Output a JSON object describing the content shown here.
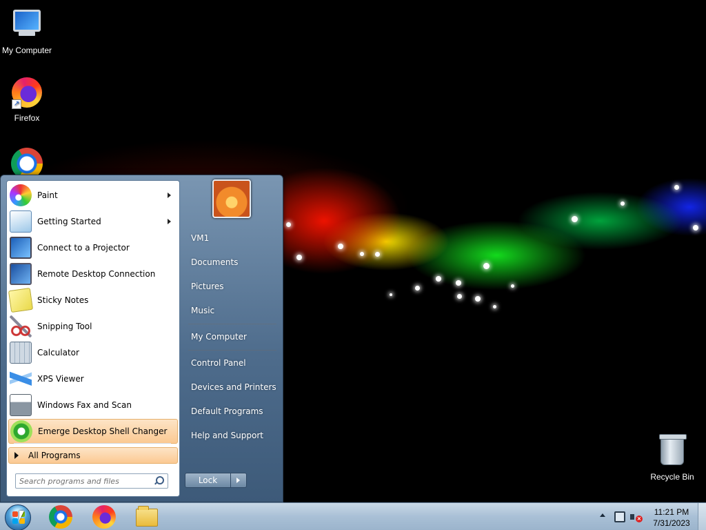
{
  "desktop": {
    "icons": [
      {
        "label": "My Computer",
        "icon": "computer-icon"
      },
      {
        "label": "Firefox",
        "icon": "firefox-icon"
      },
      {
        "label": "",
        "icon": "chrome-icon"
      },
      {
        "label": "Recycle Bin",
        "icon": "recycle-bin-icon"
      }
    ]
  },
  "start_menu": {
    "programs": [
      {
        "label": "Paint",
        "icon": "paint-icon",
        "has_submenu": true
      },
      {
        "label": "Getting Started",
        "icon": "getting-started-icon",
        "has_submenu": true
      },
      {
        "label": "Connect to a Projector",
        "icon": "projector-icon",
        "has_submenu": false
      },
      {
        "label": "Remote Desktop Connection",
        "icon": "remote-desktop-icon",
        "has_submenu": false
      },
      {
        "label": "Sticky Notes",
        "icon": "sticky-notes-icon",
        "has_submenu": false
      },
      {
        "label": "Snipping Tool",
        "icon": "scissors-icon",
        "has_submenu": false
      },
      {
        "label": "Calculator",
        "icon": "calculator-icon",
        "has_submenu": false
      },
      {
        "label": "XPS Viewer",
        "icon": "xps-viewer-icon",
        "has_submenu": false
      },
      {
        "label": "Windows Fax and Scan",
        "icon": "fax-icon",
        "has_submenu": false
      },
      {
        "label": "Emerge Desktop Shell Changer",
        "icon": "emerge-icon",
        "has_submenu": false,
        "highlighted": true
      }
    ],
    "all_programs_label": "All Programs",
    "search_placeholder": "Search programs and files",
    "right_links": [
      {
        "label": "VM1"
      },
      {
        "label": "Documents"
      },
      {
        "label": "Pictures"
      },
      {
        "label": "Music"
      },
      {
        "label": "My Computer"
      },
      {
        "label": "Control Panel"
      },
      {
        "label": "Devices and Printers"
      },
      {
        "label": "Default Programs"
      },
      {
        "label": "Help and Support"
      }
    ],
    "lock_label": "Lock"
  },
  "taskbar": {
    "pinned": [
      "chrome-icon",
      "firefox-icon",
      "folder-icon"
    ],
    "clock_time": "11:21 PM",
    "clock_date": "7/31/2023"
  },
  "colors": {
    "highlight": "#fbc992",
    "taskbar": "#a9c0d6",
    "menu_frame": "#4e6c8c"
  }
}
